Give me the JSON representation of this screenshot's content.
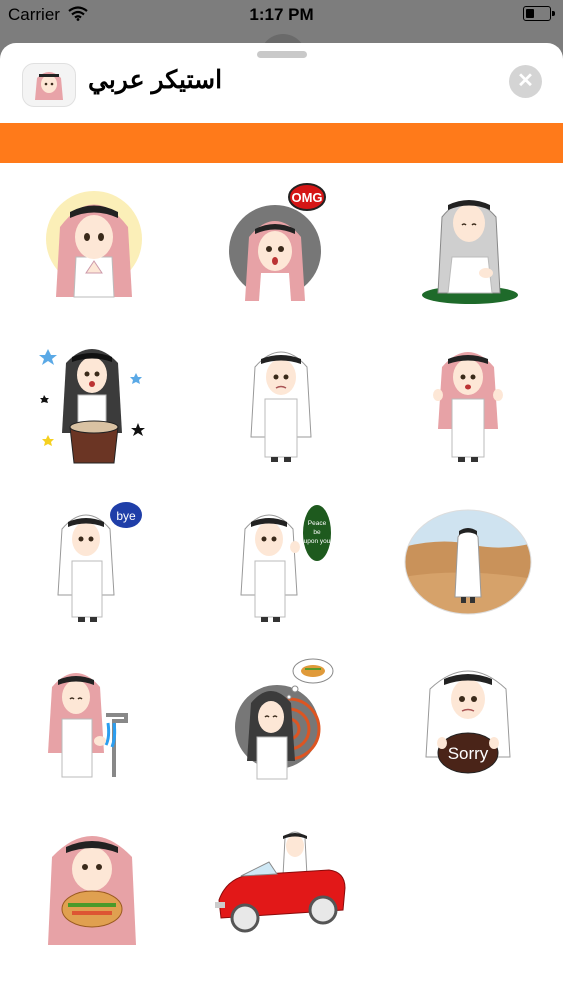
{
  "status_bar": {
    "carrier": "Carrier",
    "time": "1:17 PM"
  },
  "header": {
    "title": "استيكر عربي"
  },
  "banner": {
    "color": "#FF7A1A"
  },
  "stickers": [
    {
      "name": "sticker-praying-halo",
      "text": ""
    },
    {
      "name": "sticker-omg",
      "text": "OMG"
    },
    {
      "name": "sticker-sitting-prayer",
      "text": ""
    },
    {
      "name": "sticker-drum-party",
      "text": ""
    },
    {
      "name": "sticker-sad",
      "text": ""
    },
    {
      "name": "sticker-waving-pink",
      "text": ""
    },
    {
      "name": "sticker-bye",
      "text": "bye"
    },
    {
      "name": "sticker-peace-be-upon-you",
      "text": "Peace be upon you"
    },
    {
      "name": "sticker-desert-walk",
      "text": ""
    },
    {
      "name": "sticker-washing-hands",
      "text": ""
    },
    {
      "name": "sticker-dreaming-food",
      "text": ""
    },
    {
      "name": "sticker-sorry",
      "text": "Sorry"
    },
    {
      "name": "sticker-eating-shawarma",
      "text": ""
    },
    {
      "name": "sticker-red-convertible",
      "text": ""
    }
  ]
}
